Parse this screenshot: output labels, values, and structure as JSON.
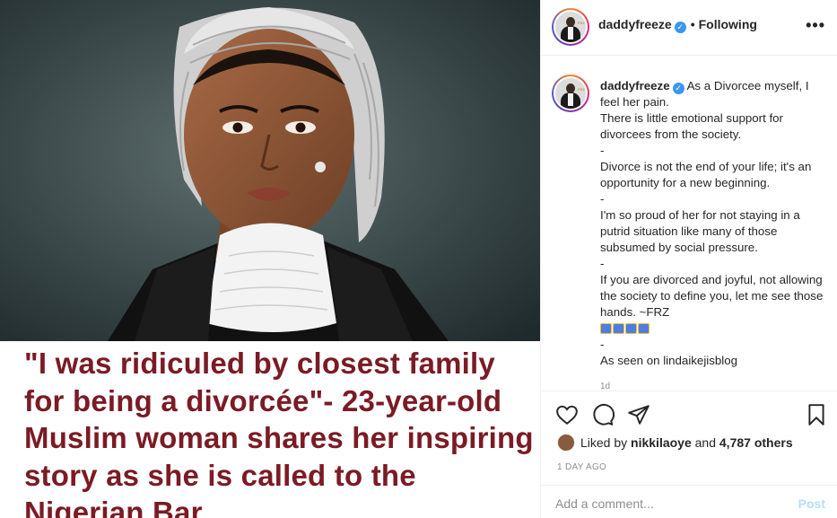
{
  "post": {
    "headline": "\"I was ridiculed by closest family for being a divorcée\"- 23-year-old Muslim woman shares her inspiring story as she is called to the Nigerian Bar",
    "headline_color": "#7b1b24"
  },
  "header": {
    "username": "daddyfreeze",
    "separator": "•",
    "follow_status": "Following",
    "more_label": "•••"
  },
  "caption": {
    "username": "daddyfreeze",
    "lines": [
      "As a Divorcee myself, I feel her pain.",
      "There is little emotional support for divorcees from the society.",
      "-",
      "Divorce is not the end of your life; it's an opportunity for a new beginning.",
      "-",
      "I'm so proud of her for not staying in a putrid situation like many of those subsumed by social pressure.",
      "-",
      "If you are divorced and joyful, not allowing the society to define you, let me see those hands. ~FRZ",
      "-",
      "As seen on lindaikejisblog"
    ],
    "time_short": "1d"
  },
  "actions": {
    "like": "heart-icon",
    "comment": "comment-icon",
    "share": "paper-plane-icon",
    "save": "bookmark-icon"
  },
  "likes": {
    "prefix": "Liked by",
    "user": "nikkilaoye",
    "conjunction": "and",
    "others": "4,787 others"
  },
  "posted": "1 DAY AGO",
  "comment": {
    "placeholder": "Add a comment...",
    "post_label": "Post"
  },
  "colors": {
    "verified": "#3897f0",
    "post_button": "#b2dffc",
    "muted": "#8e8e8e"
  }
}
